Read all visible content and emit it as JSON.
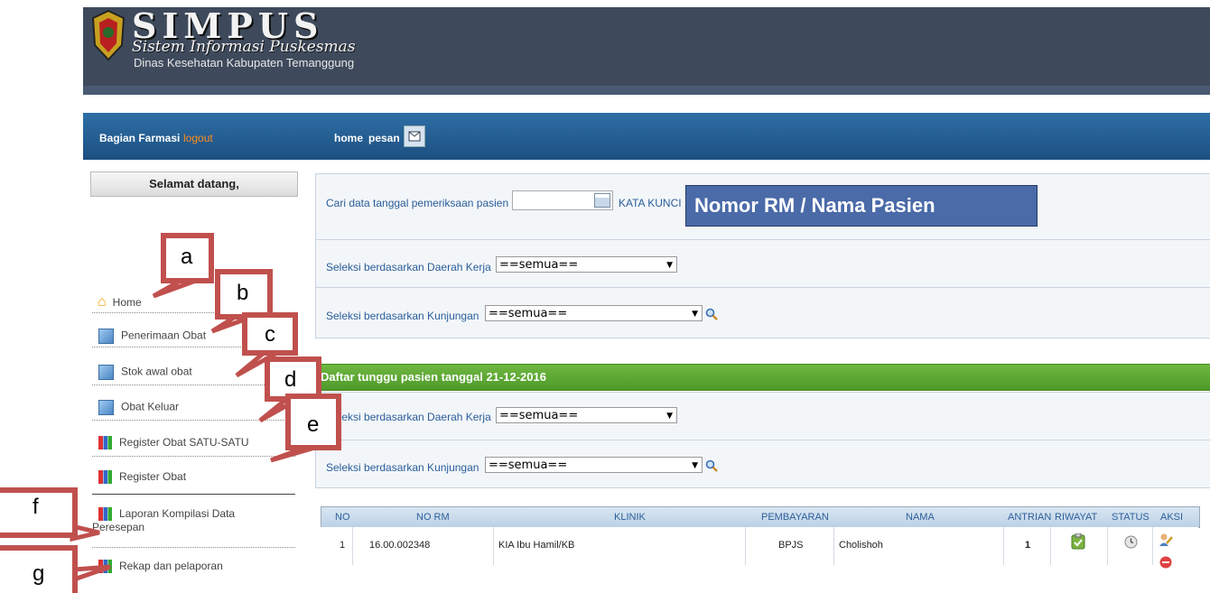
{
  "header": {
    "title": "SIMPUS",
    "subtitle": "Sistem Informasi Puskesmas",
    "org": "Dinas Kesehatan Kabupaten Temanggung"
  },
  "navbar": {
    "role": "Bagian Farmasi",
    "logout": "logout",
    "home": "home",
    "pesan": "pesan"
  },
  "sidebar": {
    "welcome": "Selamat datang,",
    "items": [
      {
        "label": "Home",
        "icon": "home-icon"
      },
      {
        "label": "Penerimaan Obat",
        "icon": "edit-icon"
      },
      {
        "label": "Stok awal obat",
        "icon": "edit-icon"
      },
      {
        "label": "Obat Keluar",
        "icon": "edit-icon"
      },
      {
        "label": "Register Obat SATU-SATU",
        "icon": "chart-icon"
      },
      {
        "label": "Register Obat",
        "icon": "chart-icon"
      },
      {
        "label": "Laporan Kompilasi Data",
        "label2": "Peresepan",
        "icon": "chart-icon"
      },
      {
        "label": "Rekap dan pelaporan",
        "icon": "chart-icon"
      }
    ]
  },
  "search": {
    "date_label": "Cari data tanggal pemeriksaan pasien",
    "date_value": "",
    "keyword_label": "KATA KUNCI",
    "keyword_placeholder": "Nomor RM / Nama Pasien",
    "daerah_label": "Seleksi berdasarkan Daerah Kerja",
    "daerah_value": "==semua==",
    "kunjungan_label": "Seleksi berdasarkan Kunjungan",
    "kunjungan_value": "==semua=="
  },
  "queue": {
    "title": "Daftar tunggu pasien tanggal 21-12-2016",
    "daerah_label": "Seleksi berdasarkan Daerah Kerja",
    "daerah_value": "==semua==",
    "kunjungan_label": "Seleksi berdasarkan Kunjungan",
    "kunjungan_value": "==semua=="
  },
  "table": {
    "headers": [
      "NO",
      "NO RM",
      "KLINIK",
      "PEMBAYARAN",
      "NAMA",
      "ANTRIAN",
      "RIWAYAT",
      "STATUS",
      "AKSI"
    ],
    "rows": [
      {
        "no": "1",
        "no_rm": "16.00.002348",
        "klinik": "KIA Ibu Hamil/KB",
        "pembayaran": "BPJS",
        "nama": "Cholishoh",
        "antrian": "1"
      }
    ]
  },
  "callouts": [
    "a",
    "b",
    "c",
    "d",
    "e",
    "f",
    "g"
  ],
  "colors": {
    "header": "#3e4a5c",
    "navbar": "#1c4f80",
    "accent_green": "#4e9a2a",
    "callout_border": "#c0504d",
    "link_blue": "#2a5d9a"
  }
}
